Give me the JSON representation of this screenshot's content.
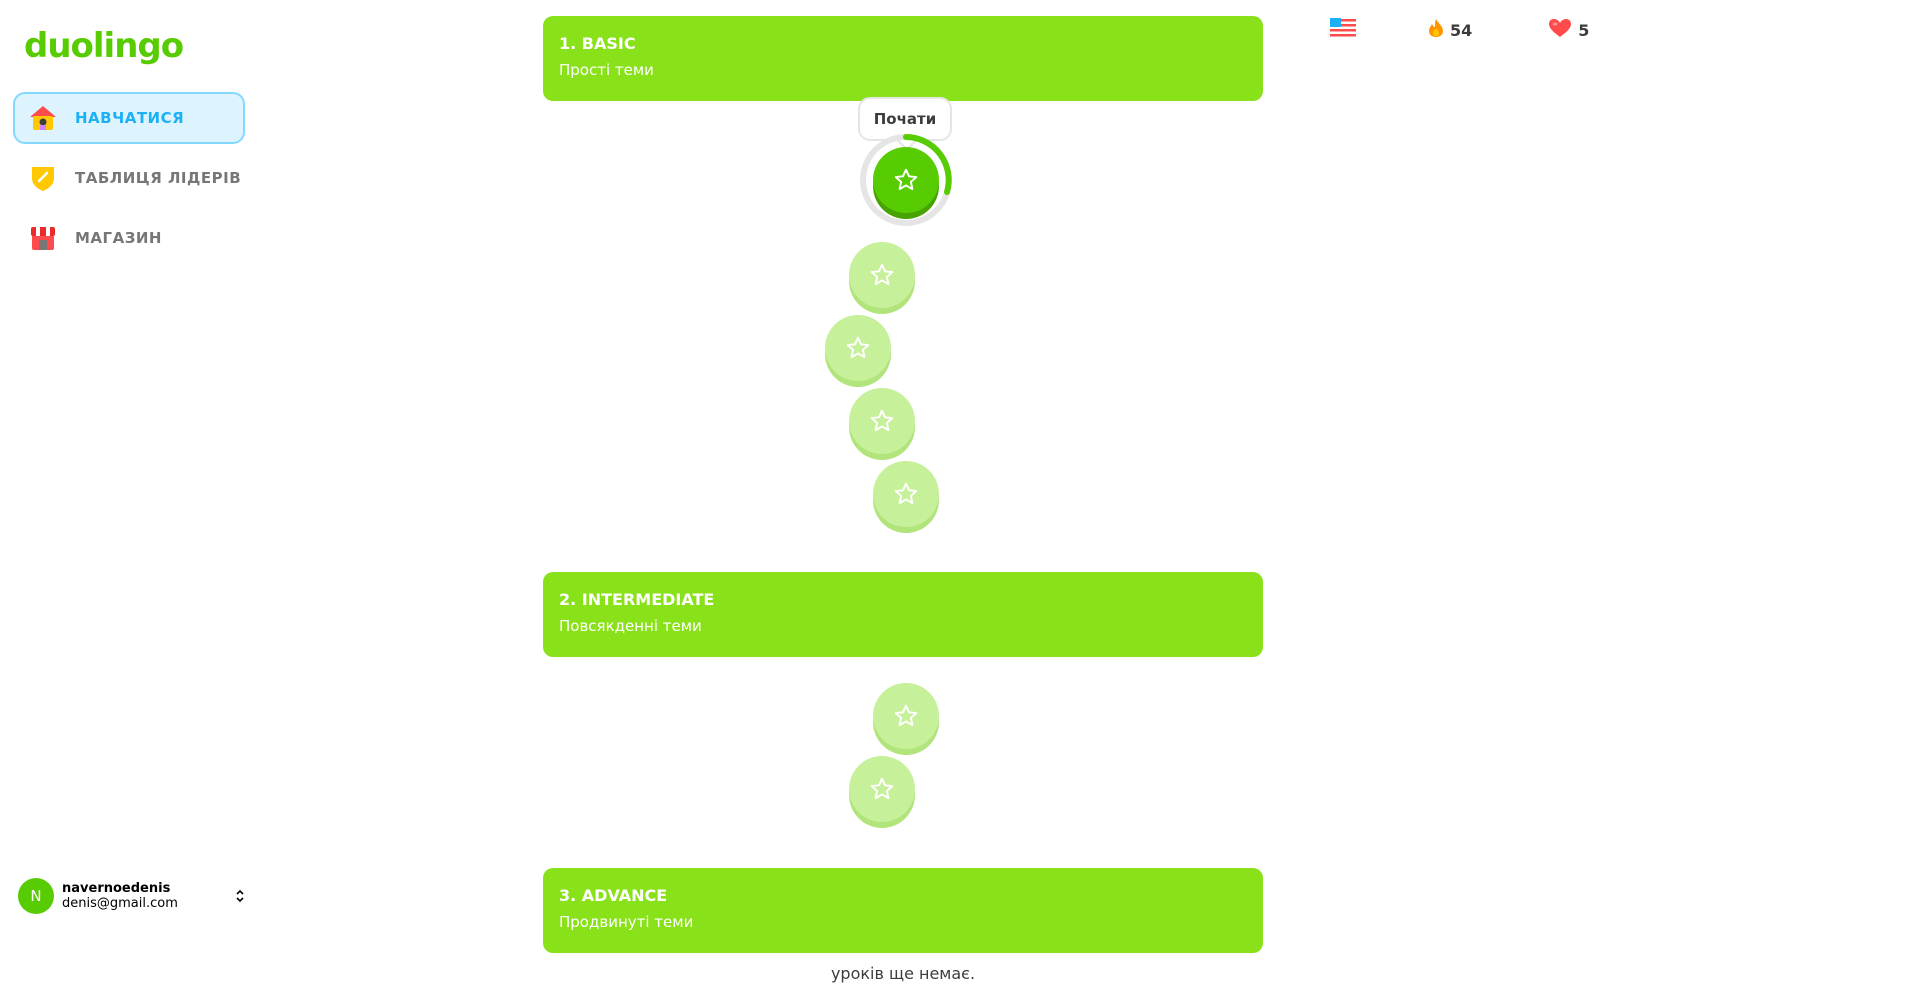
{
  "app": {
    "logo": "duolingo"
  },
  "sidebar": {
    "items": [
      {
        "label": "НАВЧАТИСЯ",
        "icon": "home-icon",
        "active": true
      },
      {
        "label": "ТАБЛИЦЯ ЛІДЕРІВ",
        "icon": "shield-icon",
        "active": false
      },
      {
        "label": "МАГАЗИН",
        "icon": "shop-icon",
        "active": false
      }
    ]
  },
  "user": {
    "initial": "N",
    "name": "navernoedenis",
    "email": "denis@gmail.com"
  },
  "stats": {
    "language_icon": "us-flag-icon",
    "streak": "54",
    "hearts": "5"
  },
  "units": [
    {
      "title": "1. BASIC",
      "subtitle": "Прості теми"
    },
    {
      "title": "2. INTERMEDIATE",
      "subtitle": "Повсякденні теми"
    },
    {
      "title": "3. ADVANCE",
      "subtitle": "Продвинуті теми"
    }
  ],
  "tooltip": {
    "label": "Почати"
  },
  "empty_message": "уроків ще немає.",
  "colors": {
    "brand": "#58cc02",
    "unit_bg": "#89e219",
    "lesson_locked": "#c7f09a",
    "active_nav": "#1cb0f6"
  }
}
